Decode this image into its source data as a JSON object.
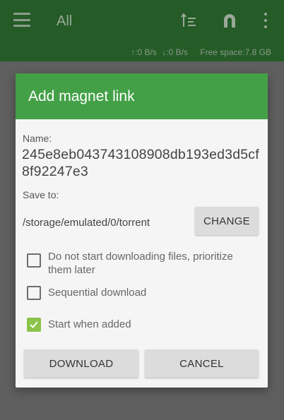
{
  "appbar": {
    "title": "All",
    "upload_speed": "↑:0 B/s",
    "download_speed": "↓:0 B/s",
    "free_space": "Free space:7.8 GB",
    "menu_icon": "hamburger-menu-icon",
    "sort_icon": "sort-icon",
    "magnet_icon": "magnet-icon",
    "more_icon": "more-vert-icon",
    "color": "#245b26"
  },
  "dialog": {
    "title": "Add magnet link",
    "header_color": "#43a047",
    "name_label": "Name:",
    "name_value": "245e8eb043743108908db193ed3d5cf8f92247e3",
    "save_label": "Save to:",
    "save_path": "/storage/emulated/0/torrent",
    "change_label": "CHANGE",
    "options": [
      {
        "label": "Do not start downloading files, prioritize them later",
        "checked": false
      },
      {
        "label": "Sequential download",
        "checked": false
      },
      {
        "label": "Start when added",
        "checked": true
      }
    ],
    "download_label": "DOWNLOAD",
    "cancel_label": "CANCEL",
    "checkbox_color": "#8bc34a"
  }
}
